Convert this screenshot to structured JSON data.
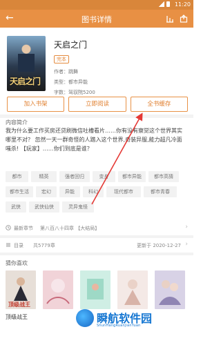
{
  "status_bar": {
    "time": "11:20"
  },
  "header": {
    "back_glyph": "←",
    "title": "图书详情"
  },
  "book": {
    "cover_text": "天启之门",
    "title": "天启之门",
    "status": "完本",
    "author": "作者：跳舞",
    "category": "类型：都市异能",
    "word_count": "字数：驾驭院5200"
  },
  "actions": {
    "add_shelf": "加入书架",
    "read_now": "立即阅读",
    "cache_all": "全书缓存"
  },
  "intro": {
    "section_title": "内容简介",
    "text": "我为什么要工作买房还贷刷微信吐槽看片……你有没有察觉这个世界其实哪里不对？ 忽然一天一群奇怪的人踏入这个世界,奇装异服,能力超凡冷面嗤杀! 【玩家】……你们到底是谁？"
  },
  "tags": [
    "都市",
    "精英",
    "强者回归",
    "变身",
    "都市异能",
    "都市高猜",
    "都市生活",
    "宏幻",
    "异能",
    "科幻",
    "现代都市",
    "都市青春",
    "武侠",
    "武侠仙侠",
    "灵异鬼怪"
  ],
  "latest": {
    "label": "最新章节",
    "value": "第八百八十四章 【大结局】"
  },
  "toc": {
    "label": "目录",
    "value": "共5779章",
    "updated": "更新于 2020-12-27"
  },
  "recommend": {
    "section_title": "猜你喜欢",
    "items": [
      {
        "name": "顶级战王",
        "color": "#e7dfd8"
      },
      {
        "name": "",
        "color": "#f1d3d8"
      },
      {
        "name": "",
        "color": "#cfeee4"
      },
      {
        "name": "",
        "color": "#f4e9e6"
      },
      {
        "name": "",
        "color": "#d8d2e6"
      }
    ]
  },
  "watermark": {
    "title": "瞬航软件园",
    "subtitle": "ShunHangRuanJianYuan"
  },
  "colors": {
    "accent": "#e89044",
    "status_bar": "#d9863a"
  }
}
